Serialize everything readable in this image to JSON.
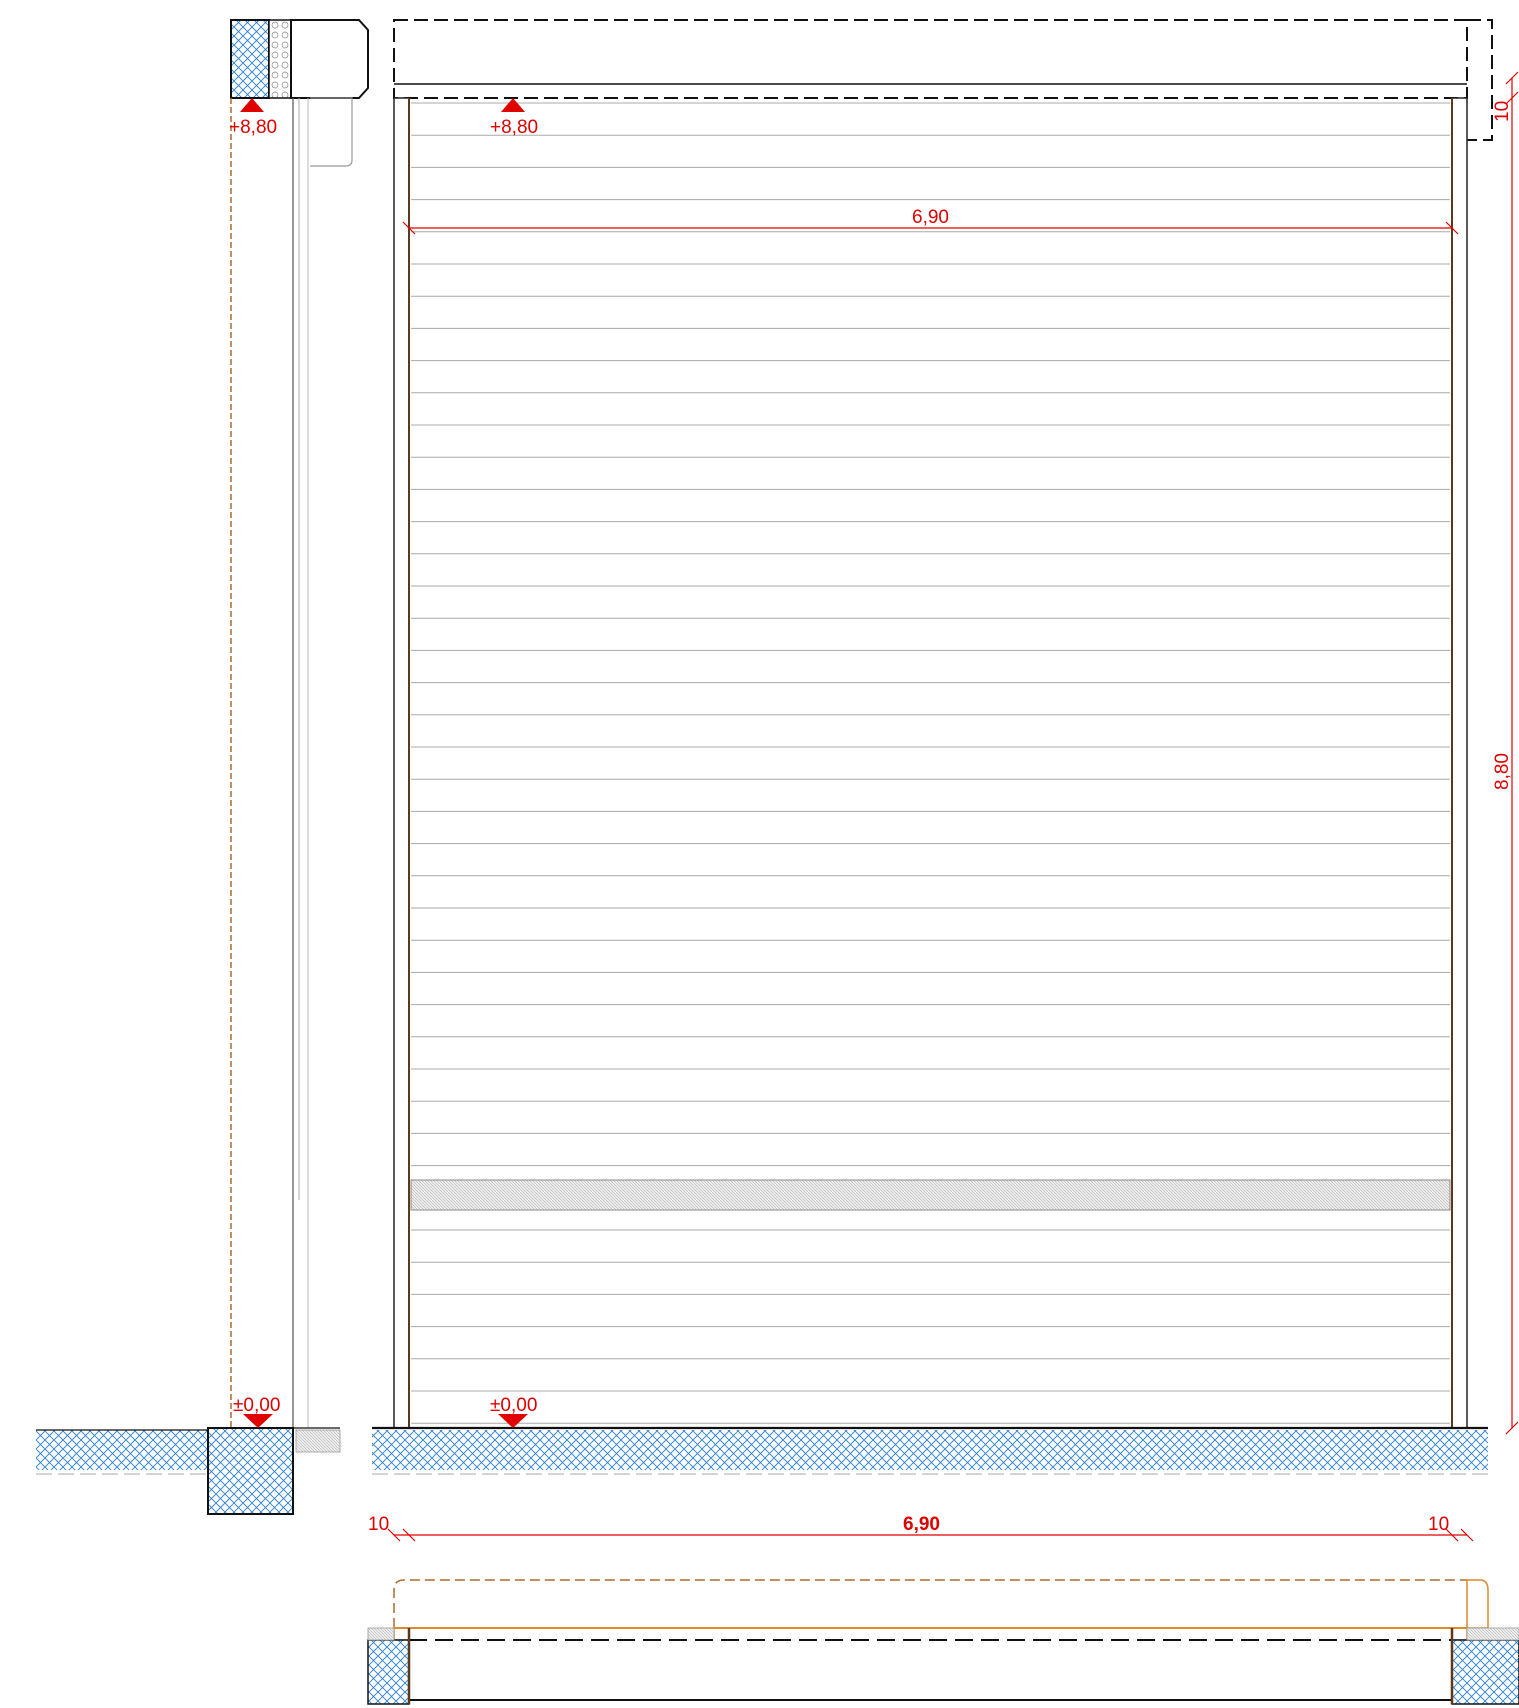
{
  "section": {
    "top_level": "+8,80",
    "floor_level": "±0,00"
  },
  "elevation": {
    "top_level": "+8,80",
    "floor_level": "±0,00",
    "inner_width": "6,90",
    "total_height": "8,80",
    "box_height": "10"
  },
  "plan": {
    "left_jamb": "10",
    "width": "6,90",
    "right_jamb": "10"
  },
  "colors": {
    "dimension": "#e00000",
    "hatch": "#2a7fd4",
    "frame": "#5a3a1a",
    "guide": "#e08a2a"
  }
}
